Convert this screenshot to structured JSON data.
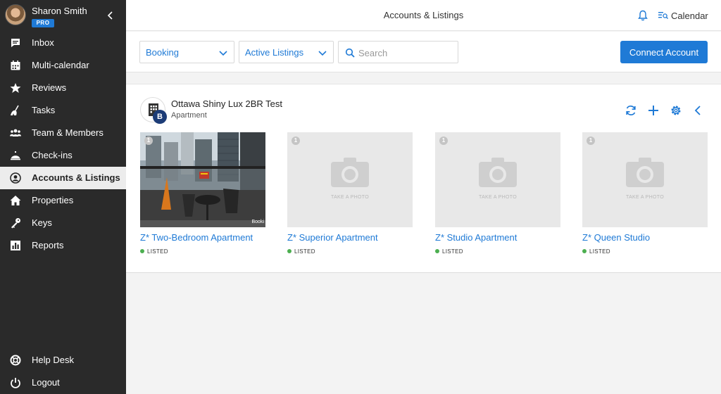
{
  "colors": {
    "accent": "#1f7ad6",
    "sidebar": "#2a2a2a",
    "listed": "#4caf50",
    "badge": "#1c3c77"
  },
  "profile": {
    "name": "Sharon Smith",
    "badge": "PRO"
  },
  "nav": [
    {
      "label": "Inbox",
      "icon": "chat-icon"
    },
    {
      "label": "Multi-calendar",
      "icon": "calendar-icon"
    },
    {
      "label": "Reviews",
      "icon": "star-icon"
    },
    {
      "label": "Tasks",
      "icon": "broom-icon"
    },
    {
      "label": "Team & Members",
      "icon": "team-icon"
    },
    {
      "label": "Check-ins",
      "icon": "bell-service-icon"
    },
    {
      "label": "Accounts & Listings",
      "icon": "account-icon",
      "active": true
    },
    {
      "label": "Properties",
      "icon": "home-icon"
    },
    {
      "label": "Keys",
      "icon": "key-icon"
    },
    {
      "label": "Reports",
      "icon": "chart-icon"
    }
  ],
  "bottom_nav": [
    {
      "label": "Help Desk",
      "icon": "lifebuoy-icon"
    },
    {
      "label": "Logout",
      "icon": "power-icon"
    }
  ],
  "header": {
    "title": "Accounts & Listings",
    "calendar_label": "Calendar"
  },
  "filters": {
    "channel": "Booking",
    "listing_status": "Active Listings",
    "search_placeholder": "Search",
    "connect_label": "Connect Account"
  },
  "account": {
    "name": "Ottawa Shiny Lux 2BR Test",
    "type": "Apartment",
    "badge": "B",
    "listings": [
      {
        "title": "Z* Two-Bedroom Apartment",
        "status": "LISTED",
        "photo_count": "1",
        "has_photo": true,
        "photo_label": "Booki"
      },
      {
        "title": "Z* Superior Apartment",
        "status": "LISTED",
        "photo_count": "1",
        "has_photo": false,
        "placeholder": "TAKE A PHOTO"
      },
      {
        "title": "Z* Studio Apartment",
        "status": "LISTED",
        "photo_count": "1",
        "has_photo": false,
        "placeholder": "TAKE A PHOTO"
      },
      {
        "title": "Z* Queen Studio",
        "status": "LISTED",
        "photo_count": "1",
        "has_photo": false,
        "placeholder": "TAKE A PHOTO"
      }
    ]
  }
}
